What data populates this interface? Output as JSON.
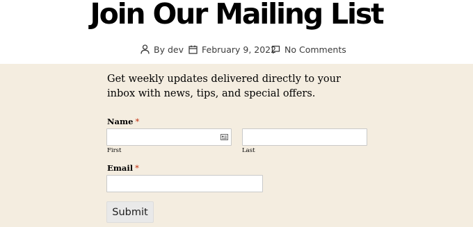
{
  "post": {
    "title": "Join Our Mailing List",
    "author_label": "By dev",
    "date": "February 9, 2022",
    "comments": "No Comments"
  },
  "form": {
    "intro": "Get weekly updates delivered directly to your inbox with news, tips, and special offers.",
    "name_label": "Name",
    "required_mark": "*",
    "first_sublabel": "First",
    "last_sublabel": "Last",
    "first_value": "",
    "last_value": "",
    "email_label": "Email",
    "email_value": "",
    "submit_label": "Submit"
  },
  "icons": {
    "author": "person-icon",
    "date": "calendar-icon",
    "comments": "speech-bubble-icon",
    "first_field": "contact-card-icon"
  },
  "colors": {
    "content_background": "#f4ede0",
    "required": "#c02b0a",
    "button_background": "#e9e9e9"
  }
}
